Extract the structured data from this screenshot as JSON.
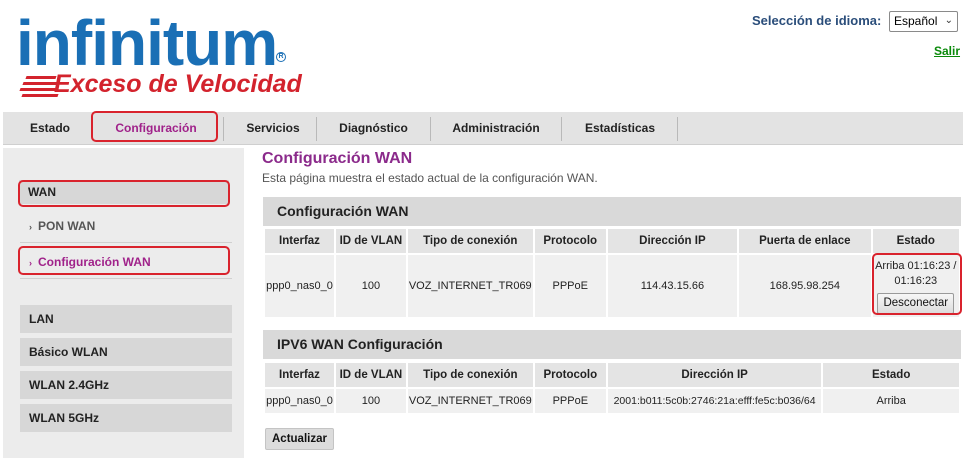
{
  "brand": {
    "name": "infinitum",
    "tagline": "Exceso de Velocidad",
    "registered": "R"
  },
  "header": {
    "language_label": "Selección de idioma:",
    "language_value": "Español",
    "logout": "Salir"
  },
  "nav": {
    "items": [
      "Estado",
      "Configuración",
      "Servicios",
      "Diagnóstico",
      "Administración",
      "Estadísticas"
    ],
    "active": "Configuración"
  },
  "sidebar": {
    "wan": "WAN",
    "pon_wan": "PON WAN",
    "wan_config": "Configuración WAN",
    "lan": "LAN",
    "basic_wlan": "Básico WLAN",
    "wlan24": "WLAN 2.4GHz",
    "wlan5": "WLAN 5GHz"
  },
  "main": {
    "title": "Configuración WAN",
    "description": "Esta página muestra el estado actual de la configuración WAN.",
    "ipv4": {
      "heading": "Configuración WAN",
      "headers": [
        "Interfaz",
        "ID de VLAN",
        "Tipo de conexión",
        "Protocolo",
        "Dirección IP",
        "Puerta de enlace",
        "Estado"
      ],
      "row": {
        "interface": "ppp0_nas0_0",
        "vlan": "100",
        "type": "VOZ_INTERNET_TR069",
        "protocol": "PPPoE",
        "ip": "114.43.15.66",
        "gateway": "168.95.98.254",
        "status": "Arriba 01:16:23 / 01:16:23",
        "disconnect": "Desconectar"
      }
    },
    "ipv6": {
      "heading": "IPV6 WAN Configuración",
      "headers": [
        "Interfaz",
        "ID de VLAN",
        "Tipo de conexión",
        "Protocolo",
        "Dirección IP",
        "Estado"
      ],
      "row": {
        "interface": "ppp0_nas0_0",
        "vlan": "100",
        "type": "VOZ_INTERNET_TR069",
        "protocol": "PPPoE",
        "ip": "2001:b011:5c0b:2746:21a:efff:fe5c:b036/64",
        "status": "Arriba"
      }
    },
    "update_button": "Actualizar"
  },
  "colors": {
    "brand_blue": "#1a6fb5",
    "brand_red": "#d3232d",
    "highlight": "#d9232d",
    "active_purple": "#a0228a",
    "logout_green": "#0a8a0a"
  }
}
